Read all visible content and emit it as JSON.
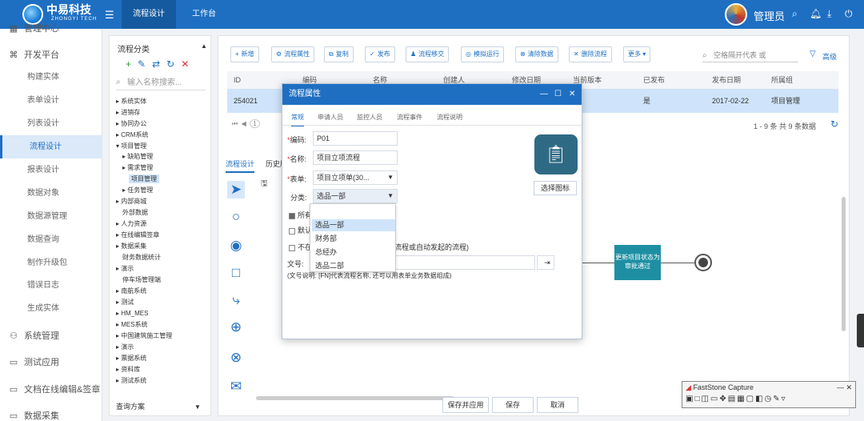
{
  "app": {
    "brand": "中易科技",
    "brand_sub": "ZHONGYI TECH"
  },
  "top_tabs": [
    "流程设计",
    "工作台"
  ],
  "user": {
    "name": "管理员"
  },
  "sidebar": {
    "cut_item": "管理中心",
    "group": "开发平台",
    "items": [
      "构建实体",
      "表单设计",
      "列表设计",
      "流程设计",
      "报表设计",
      "数据对象",
      "数据源管理",
      "数据查询",
      "制作升级包",
      "错误日志",
      "生成实体"
    ],
    "bottom": [
      "系统管理",
      "测试应用",
      "文档在线编辑&签章",
      "数据采集"
    ]
  },
  "tree": {
    "title": "流程分类",
    "search_placeholder": "输入名称搜索...",
    "nodes": [
      "系统实体",
      "进销存",
      "协同办公",
      "CRM系统",
      "项目管理",
      "缺陷管理",
      "需求管理",
      "项目管理",
      "任务管理",
      "内部商城",
      "外部数据",
      "人力资源",
      "在线编辑签章",
      "数据采集",
      "财务数据统计",
      "演示",
      "停车场管理端",
      "南航系统",
      "测试",
      "HM_MES",
      "MES系统",
      "中国建筑施工管理",
      "演示",
      "票据系统",
      "资料库",
      "测试系统"
    ],
    "footer": "查询方案"
  },
  "toolbar": {
    "buttons": [
      "新增",
      "流程属性",
      "复制",
      "发布",
      "流程移交",
      "模拟运行",
      "清除数据",
      "删除流程",
      "更多"
    ],
    "search_placeholder": "空格隔开代表 或",
    "advanced": "高级"
  },
  "grid": {
    "headers": [
      "ID",
      "编码",
      "名称",
      "创建人",
      "修改日期",
      "当前版本",
      "已发布",
      "发布日期",
      "所属组"
    ],
    "row": {
      "id": "254021",
      "published": "是",
      "date": "2017-02-22",
      "group": "项目管理"
    },
    "page_num": "1",
    "page_info": "1 - 9 条  共 9 条数据"
  },
  "design_tabs": [
    "流程设计",
    "历史版"
  ],
  "canvas": {
    "node_label": "更新项目状态为审批通过"
  },
  "modal": {
    "title": "流程属性",
    "tabs": [
      "常规",
      "申请人员",
      "监控人员",
      "流程事件",
      "流程说明"
    ],
    "code_label": "编码:",
    "code_value": "P01",
    "name_label": "名称:",
    "name_value": "项目立项流程",
    "form_label": "表单:",
    "form_value": "项目立项单(30...",
    "category_label": "分类:",
    "category_value": "选品一部",
    "check1": "所有",
    "check2": "默认",
    "check3": "不在",
    "check3_suffix": "流程或自动发起的流程)",
    "docnum_label": "文号:",
    "doc_note": "(文号说明: [FN]代表流程名称, 还可以用表单业务数据组成)",
    "choose_icon": "选择图标",
    "buttons": [
      "保存并应用",
      "保存",
      "取消"
    ],
    "dropdown_options": [
      "选品一部",
      "财务部",
      "总经办",
      "选品二部"
    ]
  },
  "faststone": {
    "title": "FastStone Capture"
  }
}
